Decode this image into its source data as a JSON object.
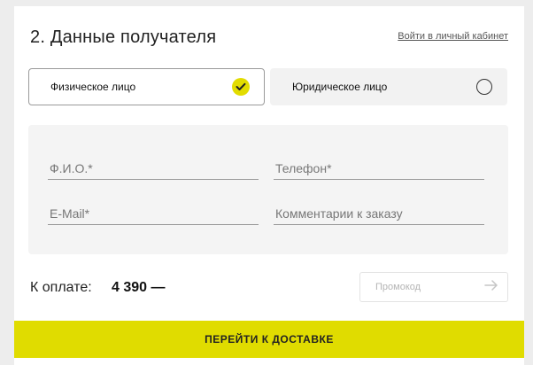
{
  "section": {
    "title": "2. Данные получателя",
    "login_link": "Войти в личный кабинет"
  },
  "customer_type": {
    "options": [
      {
        "label": "Физическое лицо",
        "selected": true
      },
      {
        "label": "Юридическое лицо",
        "selected": false
      }
    ]
  },
  "form": {
    "name_placeholder": "Ф.И.О.*",
    "phone_placeholder": "Телефон*",
    "email_placeholder": "E-Mail*",
    "comment_placeholder": "Комментарии к заказу"
  },
  "payment": {
    "label": "К оплате:",
    "amount": "4 390 —"
  },
  "promo": {
    "placeholder": "Промокод",
    "submit_icon": "arrow-right-icon"
  },
  "submit": {
    "label": "ПЕРЕЙТИ К ДОСТАВКЕ"
  },
  "colors": {
    "accent": "#e0dc00",
    "background": "#ededed",
    "form_background": "#f4f4f4"
  }
}
